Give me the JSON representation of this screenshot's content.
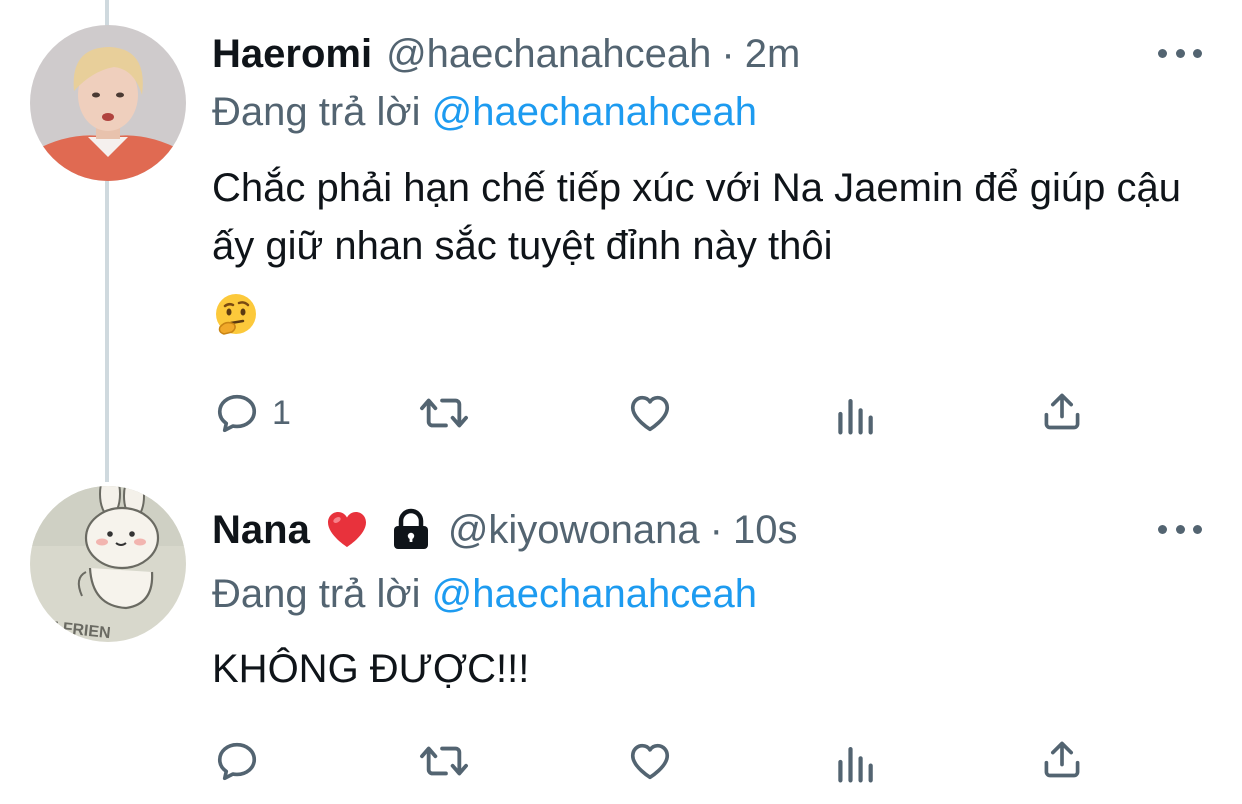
{
  "tweets": [
    {
      "name": "Haeromi",
      "handle": "@haechanahceah",
      "separator": "·",
      "time": "2m",
      "reply_prefix": "Đang trả lời",
      "reply_mention": "@haechanahceah",
      "text": "Chắc phải hạn chế tiếp xúc với Na Jaemin để giúp cậu ấy giữ nhan sắc tuyệt đỉnh này thôi",
      "emoji": "thinking-face",
      "reply_count": "1",
      "avatar": "profile-photo-person",
      "icons": [
        "reply-icon",
        "retweet-icon",
        "like-icon",
        "analytics-icon",
        "share-icon"
      ]
    },
    {
      "name": "Nana",
      "name_emoji": "red-heart",
      "protected": "lock-icon",
      "handle": "@kiyowonana",
      "separator": "·",
      "time": "10s",
      "reply_prefix": "Đang trả lời",
      "reply_mention": "@haechanahceah",
      "text": "KHÔNG ĐƯỢC!!!",
      "reply_count": "",
      "avatar": "profile-photo-bunny-cartoon",
      "avatar_text": "E FRIEN",
      "icons": [
        "reply-icon",
        "retweet-icon",
        "like-icon",
        "analytics-icon",
        "share-icon"
      ]
    }
  ],
  "colors": {
    "text": "#0f1419",
    "muted": "#536471",
    "link": "#1d9bf0",
    "thread_line": "#cfd9de",
    "background": "#ffffff"
  }
}
